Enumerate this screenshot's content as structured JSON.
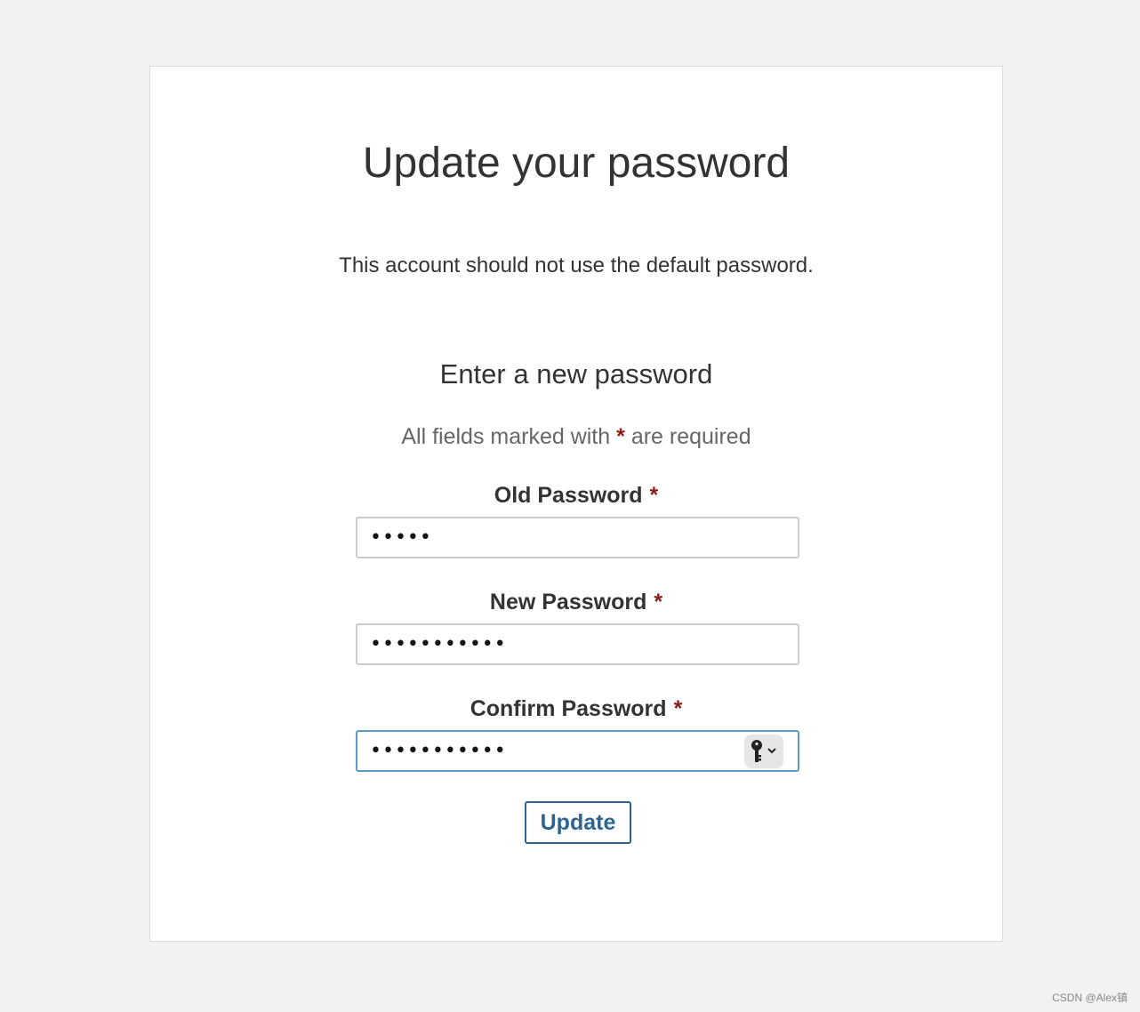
{
  "page": {
    "title": "Update your password",
    "message": "This account should not use the default password.",
    "subtitle": "Enter a new password",
    "required_note_before": "All fields marked with",
    "required_star": "*",
    "required_note_after": "are required"
  },
  "fields": [
    {
      "label": "Old Password",
      "value": "•••••",
      "required": "*"
    },
    {
      "label": "New Password",
      "value": "•••••••••••",
      "required": "*"
    },
    {
      "label": "Confirm Password",
      "value": "•••••••••••",
      "required": "*",
      "icon": "key-icon"
    }
  ],
  "actions": {
    "update_label": "Update"
  },
  "watermark": "CSDN @Alex镇",
  "colors": {
    "background": "#f2f2f2",
    "card": "#ffffff",
    "required_star": "#8b1c1c",
    "button": "#2e6590",
    "focus_border": "#5a9bc9"
  }
}
